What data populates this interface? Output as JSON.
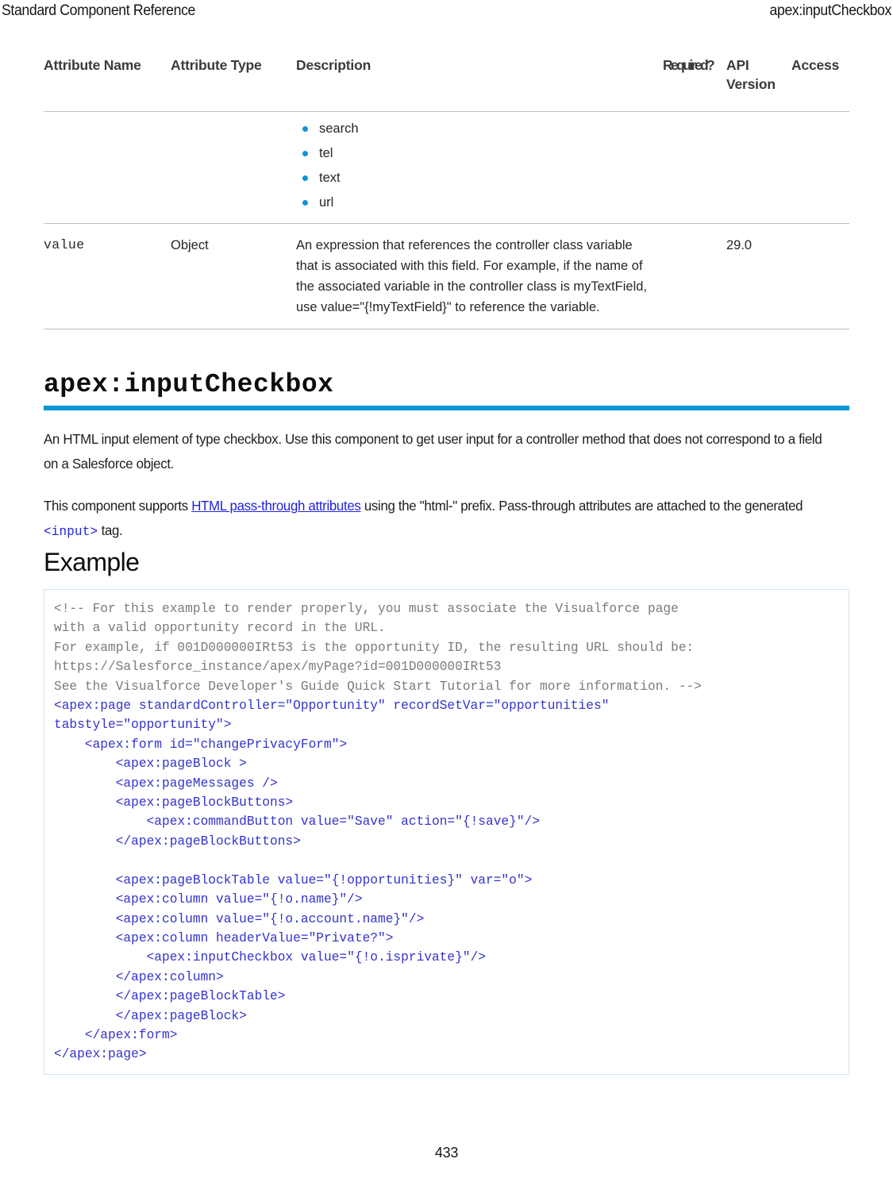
{
  "header": {
    "left_title": "Standard Component Reference",
    "right_title": "apex:inputCheckbox"
  },
  "attribute_table": {
    "columns": {
      "attribute_name": "Attribute Name",
      "attribute_type": "Attribute Type",
      "description": "Description",
      "required": "Required?",
      "api_version_line1": "API",
      "api_version_line2": "Version",
      "access": "Access"
    },
    "continued_type_list": [
      "search",
      "tel",
      "text",
      "url"
    ],
    "rows": [
      {
        "name": "value",
        "type": "Object",
        "description_lines": [
          "An expression that references the controller class variable",
          "that is associated with this field. For example, if the name of",
          "the associated variable in the controller class is myTextField,",
          "use value=\"{!myTextField}\" to reference the variable."
        ],
        "required": "",
        "api_version": "29.0",
        "access": ""
      }
    ]
  },
  "component": {
    "title": "apex:inputCheckbox",
    "paragraph_1": "An HTML input element of type checkbox. Use this component to get user input for a controller method that does not correspond to a field on a Salesforce object.",
    "paragraph_2_before_link": "This component supports ",
    "paragraph_2_link": "HTML pass-through attributes",
    "paragraph_2_after_link": " using the \"html-\" prefix. Pass-through attributes are attached to the generated ",
    "paragraph_2_code": "<input>",
    "paragraph_2_tail": " tag."
  },
  "example": {
    "heading": "Example",
    "comment_code": "<!-- For this example to render properly, you must associate the Visualforce page\nwith a valid opportunity record in the URL.\nFor example, if 001D000000IRt53 is the opportunity ID, the resulting URL should be:\nhttps://Salesforce_instance/apex/myPage?id=001D000000IRt53\nSee the Visualforce Developer's Guide Quick Start Tutorial for more information. -->",
    "markup_code": "<apex:page standardController=\"Opportunity\" recordSetVar=\"opportunities\"\ntabstyle=\"opportunity\">\n    <apex:form id=\"changePrivacyForm\">\n        <apex:pageBlock >\n        <apex:pageMessages />\n        <apex:pageBlockButtons>\n            <apex:commandButton value=\"Save\" action=\"{!save}\"/>\n        </apex:pageBlockButtons>\n\n        <apex:pageBlockTable value=\"{!opportunities}\" var=\"o\">\n        <apex:column value=\"{!o.name}\"/>\n        <apex:column value=\"{!o.account.name}\"/>\n        <apex:column headerValue=\"Private?\">\n            <apex:inputCheckbox value=\"{!o.isprivate}\"/>\n        </apex:column>\n        </apex:pageBlockTable>\n        </apex:pageBlock>\n    </apex:form>\n</apex:page>"
  },
  "footer": {
    "page_number": "433"
  },
  "colors": {
    "accent_rule": "#0096d6",
    "bullet": "#1394d5",
    "link": "#2222dd",
    "code_text": "#3333cc",
    "code_comment": "#7b7b7b",
    "code_border": "#cfe3f2",
    "table_rule": "#b8c2c9"
  }
}
